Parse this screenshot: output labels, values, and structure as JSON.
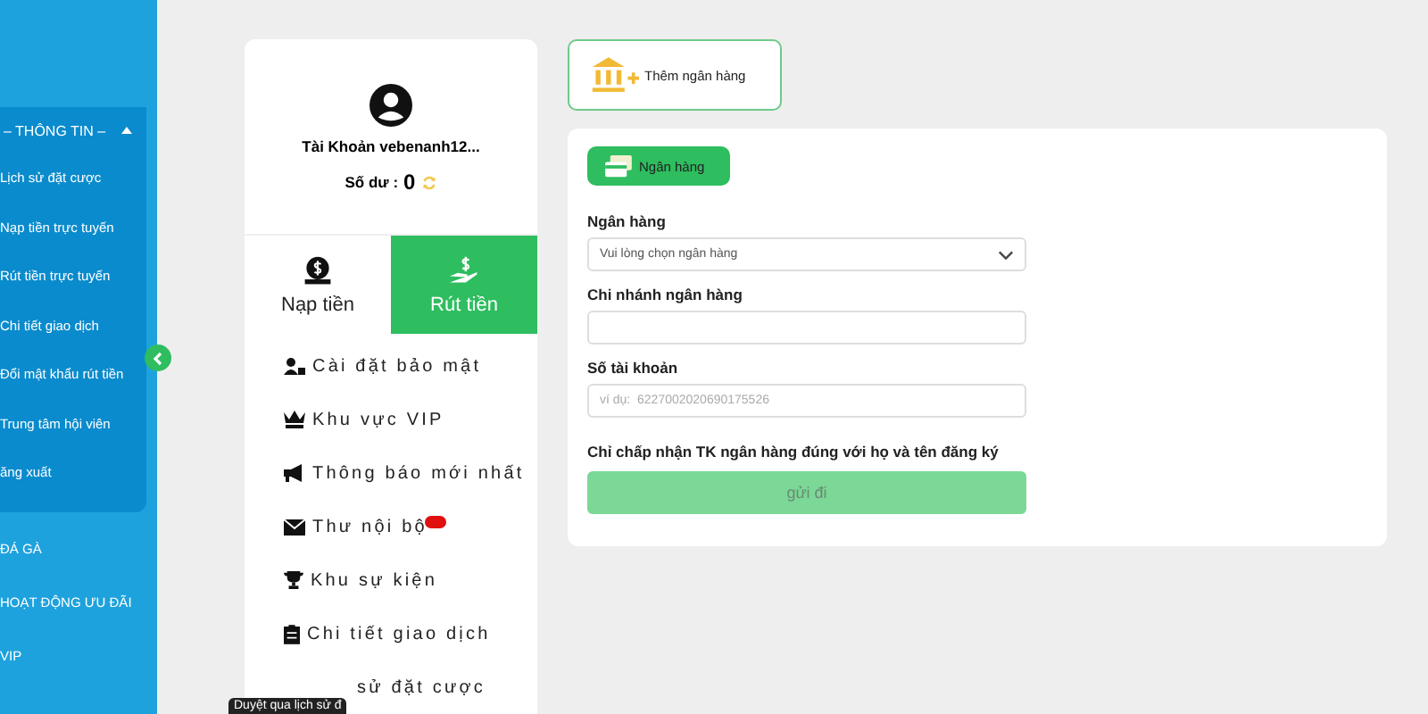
{
  "sidebar": {
    "section_title": "– THÔNG TIN –",
    "expanded": true,
    "items": [
      {
        "label": "Lịch sử đặt cược"
      },
      {
        "label": "Nạp tiền trực tuyến"
      },
      {
        "label": "Rút tiền trực tuyến"
      },
      {
        "label": "Chi tiết giao dịch"
      },
      {
        "label": "Đổi mật khẩu rút tiền"
      },
      {
        "label": "Trung tâm hội viên"
      },
      {
        "label": "ăng xuất"
      }
    ],
    "links": [
      {
        "label": "ĐÁ GÀ"
      },
      {
        "label": "HOẠT ĐỘNG ƯU ĐÃI"
      },
      {
        "label": "VIP"
      }
    ]
  },
  "profile": {
    "account": "Tài Khoản vebenanh12...",
    "balance_label": "Số dư :",
    "balance": "0",
    "tabs": [
      {
        "label": "Nạp tiền",
        "kind": "deposit",
        "selected": false
      },
      {
        "label": "Rút tiền",
        "kind": "withdraw",
        "selected": true
      }
    ],
    "menu": [
      {
        "label": "Cài đặt bảo mật",
        "kind": "security",
        "badge": false
      },
      {
        "label": "Khu vực VIP",
        "kind": "vip",
        "badge": false
      },
      {
        "label": "Thông báo mới nhất",
        "kind": "notice",
        "badge": false
      },
      {
        "label": "Thư nội bộ",
        "kind": "mail",
        "badge": true
      },
      {
        "label": "Khu sự kiện",
        "kind": "trophy",
        "badge": false
      },
      {
        "label": "Chi tiết giao dịch",
        "kind": "clipboard",
        "badge": false
      },
      {
        "label": "sử đặt cược",
        "kind": "hidden",
        "badge": false
      }
    ],
    "tooltip": "Duyệt qua lịch sử đ"
  },
  "add_bank": {
    "label": "Thêm ngân hàng"
  },
  "form": {
    "tab": {
      "label": "Ngân hàng",
      "selected": true
    },
    "fields": [
      {
        "label": "Ngân hàng",
        "kind": "select",
        "placeholder": "Vui lòng chọn ngân hàng"
      },
      {
        "label": "Chi nhánh ngân hàng",
        "kind": "text"
      },
      {
        "label": "Số tài khoản",
        "kind": "text",
        "placeholder": "ví dụ:  6227002020690175526"
      }
    ],
    "note": "Chỉ chấp nhận TK ngân hàng đúng với họ và tên đăng ký",
    "submit": "gửi đi"
  }
}
